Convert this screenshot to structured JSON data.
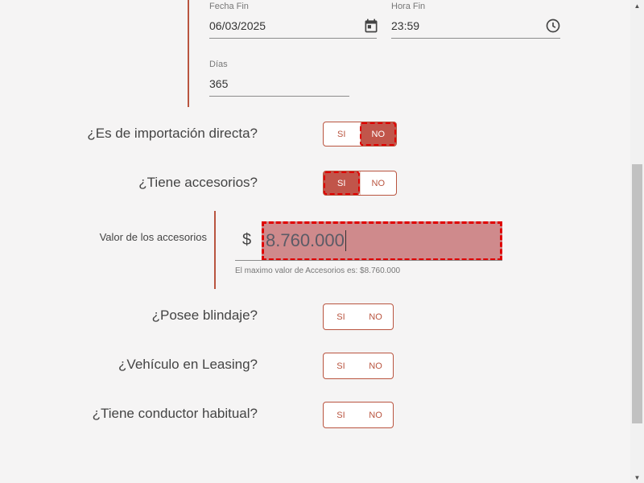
{
  "dates": {
    "fecha_fin": {
      "label": "Fecha Fin",
      "value": "06/03/2025"
    },
    "hora_fin": {
      "label": "Hora Fin",
      "value": "23:59"
    },
    "dias": {
      "label": "Días",
      "value": "365"
    }
  },
  "questions": [
    {
      "id": "importacion",
      "text": "¿Es de importación directa?",
      "yes": "SI",
      "no": "NO",
      "selected": "NO"
    },
    {
      "id": "accesorios",
      "text": "¿Tiene accesorios?",
      "yes": "SI",
      "no": "NO",
      "selected": "SI"
    },
    {
      "id": "blindaje",
      "text": "¿Posee blindaje?",
      "yes": "SI",
      "no": "NO",
      "selected": null
    },
    {
      "id": "leasing",
      "text": "¿Vehículo en Leasing?",
      "yes": "SI",
      "no": "NO",
      "selected": null
    },
    {
      "id": "conductor",
      "text": "¿Tiene conductor habitual?",
      "yes": "SI",
      "no": "NO",
      "selected": null
    }
  ],
  "accesorios_valor": {
    "label": "Valor de los accesorios",
    "currency": "$",
    "value": "8.760.000",
    "help": "El maximo valor de Accesorios es: $8.760.000"
  },
  "colors": {
    "accent": "#b9543f",
    "active_bg": "#c1554a",
    "highlight_border": "#e00000",
    "input_highlight_bg": "#cf8a8c"
  },
  "icons": {
    "fecha_fin": "calendar-icon",
    "hora_fin": "clock-icon"
  }
}
